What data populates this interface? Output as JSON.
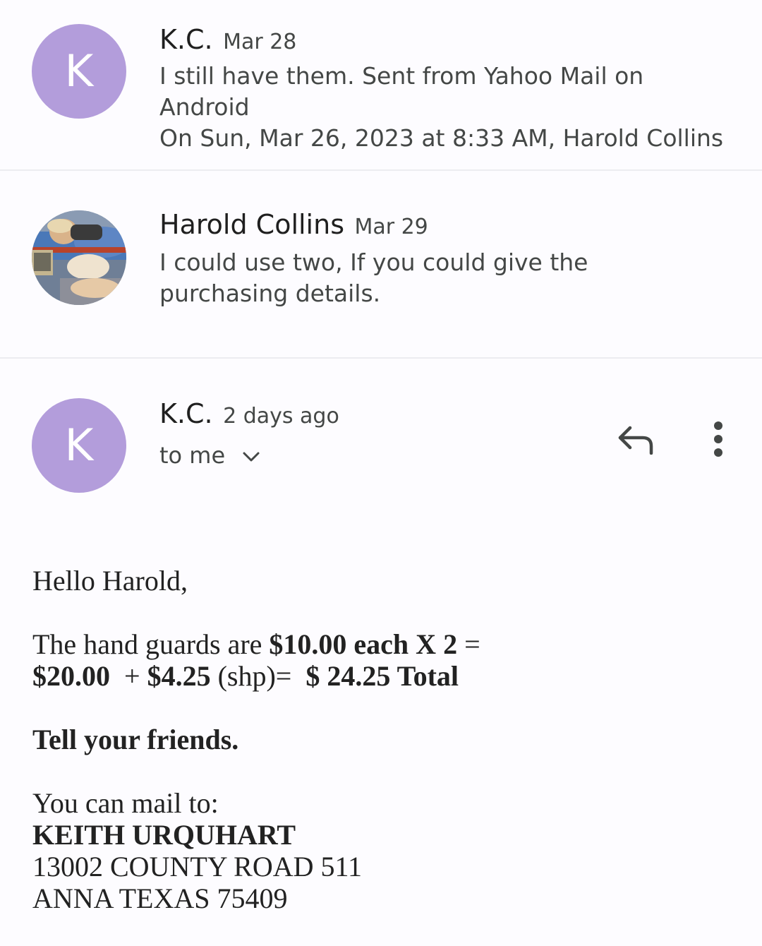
{
  "messages": [
    {
      "sender": "K.C.",
      "date": "Mar 28",
      "avatar_letter": "K",
      "snippet_line1": "I still have them. Sent from Yahoo Mail on Android",
      "snippet_line2": "On Sun, Mar 26, 2023 at 8:33 AM, Harold Collins"
    },
    {
      "sender": "Harold Collins",
      "date": "Mar 29",
      "snippet": "I could use two, If you could give the purchasing details."
    }
  ],
  "open_message": {
    "sender": "K.C.",
    "date": "2 days ago",
    "avatar_letter": "K",
    "recipient_label": "to me",
    "body": {
      "greeting": "Hello Harold,",
      "price_intro": "The hand guards are ",
      "price_each": "$10.00 each X 2",
      "price_eq": " =",
      "subtotal": "$20.00",
      "plus": "  + ",
      "shipping_amount": "$4.25",
      "shipping_label": " (shp)=  ",
      "total": "$ 24.25 Total",
      "tell_friends": "Tell your friends.",
      "mail_intro": "You can mail to:",
      "mail_name": "KEITH URQUHART",
      "mail_street": "13002 COUNTY ROAD 511",
      "mail_city": "ANNA TEXAS 75409"
    }
  },
  "icons": {
    "reply": "reply-icon",
    "more": "more-vert-icon",
    "expand": "chevron-down-icon"
  },
  "colors": {
    "avatar_purple": "#b39ddb",
    "background": "#fdfcff",
    "divider": "#ececf0"
  }
}
